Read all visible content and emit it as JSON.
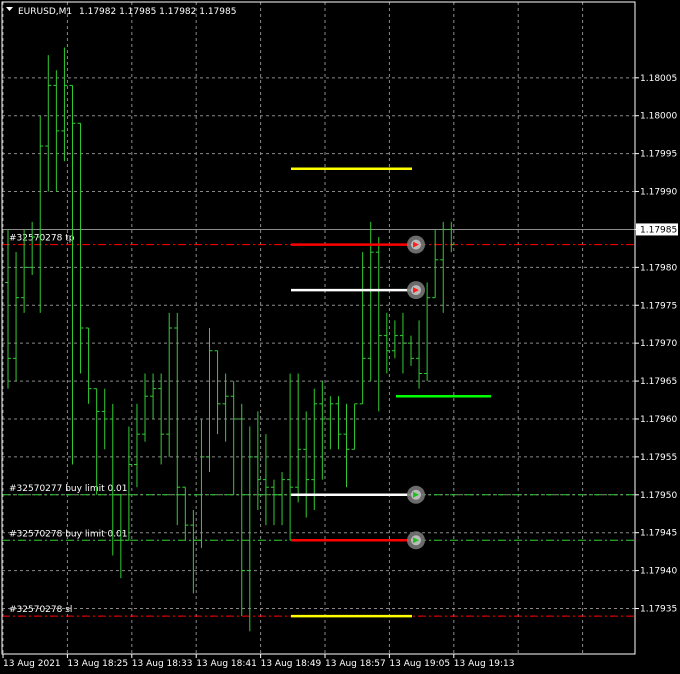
{
  "header": {
    "symbol_label": "EURUSD,M1",
    "quote": "1.17982 1.17985 1.17982 1.17985"
  },
  "chart_data": {
    "type": "ohlc",
    "symbol": "EURUSD",
    "timeframe": "M1",
    "grid": true,
    "colors": {
      "bars": "#33cc33",
      "tp": "#ff0000",
      "sl": "#ff0000",
      "order_277": "#33cc33",
      "order_278": "#33cc33",
      "bid_line": "#8c8c8c",
      "white_level": "#ffffff",
      "yellow_level": "#ffff00",
      "green_level": "#00ff00"
    },
    "ylim": [
      1.17929,
      1.18015
    ],
    "y_ticks": [
      "1.18005",
      "1.18000",
      "1.17995",
      "1.17990",
      "1.17985",
      "1.17980",
      "1.17975",
      "1.17970",
      "1.17965",
      "1.17960",
      "1.17955",
      "1.17950",
      "1.17945",
      "1.17940",
      "1.17935"
    ],
    "x_tick_labels": [
      "13 Aug 2021",
      "13 Aug 18:25",
      "13 Aug 18:33",
      "13 Aug 18:41",
      "13 Aug 18:49",
      "13 Aug 18:57",
      "13 Aug 19:05",
      "13 Aug 19:13"
    ],
    "bars": [
      [
        1.17978,
        1.17985,
        1.17964,
        1.17968
      ],
      [
        1.17968,
        1.17982,
        1.17965,
        1.17976
      ],
      [
        1.17976,
        1.17985,
        1.17974,
        1.1798
      ],
      [
        1.1798,
        1.17986,
        1.17979,
        1.17984
      ],
      [
        1.17984,
        1.18,
        1.17974,
        1.17996
      ],
      [
        1.17996,
        1.18008,
        1.1799,
        1.18004
      ],
      [
        1.18004,
        1.18006,
        1.1799,
        1.17998
      ],
      [
        1.17998,
        1.18009,
        1.17994,
        1.18004
      ],
      [
        1.18004,
        1.18,
        1.17954,
        1.17999
      ],
      [
        1.17999,
        1.17972,
        1.17966,
        1.17972
      ],
      [
        1.17972,
        1.17964,
        1.17962,
        1.17964
      ],
      [
        1.17964,
        1.17961,
        1.1795,
        1.17961
      ],
      [
        1.17961,
        1.17964,
        1.17956,
        1.1796
      ],
      [
        1.1796,
        1.17962,
        1.17942,
        1.1795
      ],
      [
        1.1795,
        1.17944,
        1.17939,
        1.17944
      ],
      [
        1.17944,
        1.17959,
        1.17946,
        1.17954
      ],
      [
        1.17954,
        1.17962,
        1.17951,
        1.17958
      ],
      [
        1.17958,
        1.17966,
        1.17957,
        1.17963
      ],
      [
        1.17963,
        1.17966,
        1.1796,
        1.17964
      ],
      [
        1.17964,
        1.17966,
        1.17954,
        1.17958
      ],
      [
        1.17958,
        1.17974,
        1.17955,
        1.17972
      ],
      [
        1.17972,
        1.17974,
        1.17946,
        1.17951
      ],
      [
        1.17951,
        1.17948,
        1.17944,
        1.17946
      ],
      [
        1.17946,
        1.17948,
        1.17937,
        1.17944
      ],
      [
        1.17944,
        1.1796,
        1.17943,
        1.17955
      ],
      [
        1.17955,
        1.17972,
        1.17953,
        1.17969
      ],
      [
        1.17969,
        1.17967,
        1.17958,
        1.17962
      ],
      [
        1.17962,
        1.17966,
        1.17957,
        1.17963
      ],
      [
        1.17963,
        1.17965,
        1.1795,
        1.1796
      ],
      [
        1.1796,
        1.17962,
        1.17934,
        1.1794
      ],
      [
        1.1794,
        1.17959,
        1.17932,
        1.17955
      ],
      [
        1.17955,
        1.17961,
        1.17948,
        1.17952
      ],
      [
        1.17952,
        1.17958,
        1.17946,
        1.17951
      ],
      [
        1.17951,
        1.17952,
        1.17946,
        1.1795
      ],
      [
        1.1795,
        1.17953,
        1.17946,
        1.17952
      ],
      [
        1.17952,
        1.17966,
        1.17944,
        1.17951
      ],
      [
        1.17951,
        1.17966,
        1.17949,
        1.17956
      ],
      [
        1.17956,
        1.17961,
        1.17947,
        1.17952
      ],
      [
        1.17952,
        1.17964,
        1.17948,
        1.17962
      ],
      [
        1.17962,
        1.17965,
        1.17952,
        1.1796
      ],
      [
        1.1796,
        1.17963,
        1.17956,
        1.17962
      ],
      [
        1.17962,
        1.17963,
        1.17956,
        1.17958
      ],
      [
        1.17958,
        1.17962,
        1.17951,
        1.17956
      ],
      [
        1.17956,
        1.17962,
        1.17962,
        1.17962
      ],
      [
        1.17962,
        1.17982,
        1.17963,
        1.17968
      ],
      [
        1.17968,
        1.17986,
        1.17965,
        1.17982
      ],
      [
        1.17982,
        1.17984,
        1.17961,
        1.17971
      ],
      [
        1.17971,
        1.17974,
        1.17966,
        1.17969
      ],
      [
        1.17969,
        1.17973,
        1.17968,
        1.17971
      ],
      [
        1.17971,
        1.17974,
        1.17966,
        1.1797
      ],
      [
        1.1797,
        1.17971,
        1.17967,
        1.17968
      ],
      [
        1.17968,
        1.17973,
        1.17964,
        1.17966
      ],
      [
        1.17966,
        1.17978,
        1.17965,
        1.17976
      ],
      [
        1.17976,
        1.17985,
        1.17977,
        1.17981
      ],
      [
        1.17981,
        1.17986,
        1.17974,
        1.17985
      ],
      [
        1.17985,
        1.17986,
        1.17982,
        1.17983
      ]
    ],
    "bid": 1.17985,
    "levels": [
      {
        "name": "tp",
        "label": "#32570278 tp",
        "price": 1.17983
      },
      {
        "name": "order-277",
        "label": "#32570277 buy limit 0.01",
        "price": 1.1795
      },
      {
        "name": "order-278",
        "label": "#32570278 buy limit 0.01",
        "price": 1.17944
      },
      {
        "name": "sl",
        "label": "#32570278 sl",
        "price": 1.17934
      }
    ],
    "segments": [
      {
        "name": "yellow-segment-top",
        "price": 1.17993,
        "color": "yellow_level"
      },
      {
        "name": "red-segment-tp",
        "price": 1.17983,
        "color": "tp"
      },
      {
        "name": "white-segment-upper",
        "price": 1.17977,
        "color": "white_level"
      },
      {
        "name": "green-segment",
        "price": 1.17963,
        "color": "green_level"
      },
      {
        "name": "white-segment-lower",
        "price": 1.1795,
        "color": "white_level"
      },
      {
        "name": "red-segment-lower",
        "price": 1.17944,
        "color": "tp"
      },
      {
        "name": "yellow-segment-bottom",
        "price": 1.17934,
        "color": "yellow_level"
      }
    ],
    "markers": [
      {
        "name": "trade-marker-tp",
        "price": 1.17983,
        "kind": "sell"
      },
      {
        "name": "trade-marker-upper",
        "price": 1.17977,
        "kind": "sell"
      },
      {
        "name": "trade-marker-277",
        "price": 1.1795,
        "kind": "buy"
      },
      {
        "name": "trade-marker-278",
        "price": 1.17944,
        "kind": "buy"
      }
    ]
  }
}
